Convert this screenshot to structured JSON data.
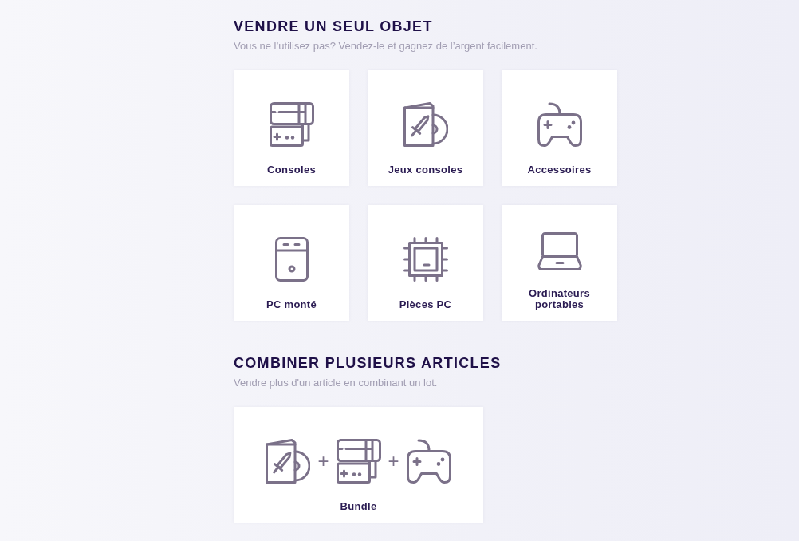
{
  "sections": [
    {
      "title": "VENDRE UN SEUL OBJET",
      "subtitle": "Vous ne l’utilisez pas? Vendez-le et gagnez de l’argent facilement.",
      "cards": [
        {
          "kind": "console",
          "label": "Consoles"
        },
        {
          "kind": "game",
          "label": "Jeux consoles"
        },
        {
          "kind": "controller",
          "label": "Accessoires"
        },
        {
          "kind": "pc",
          "label": "PC monté"
        },
        {
          "kind": "chip",
          "label": "Pièces PC"
        },
        {
          "kind": "laptop",
          "label": "Ordinateurs portables"
        }
      ]
    },
    {
      "title": "COMBINER PLUSIEURS ARTICLES",
      "subtitle": "Vendre plus d'un article en combinant un lot.",
      "cards": [
        {
          "kind": "bundle",
          "label": "Bundle",
          "parts": [
            {
              "kind": "game"
            },
            {
              "kind": "plus",
              "text": "+"
            },
            {
              "kind": "console"
            },
            {
              "kind": "plus",
              "text": "+"
            },
            {
              "kind": "controller"
            }
          ]
        }
      ]
    }
  ]
}
